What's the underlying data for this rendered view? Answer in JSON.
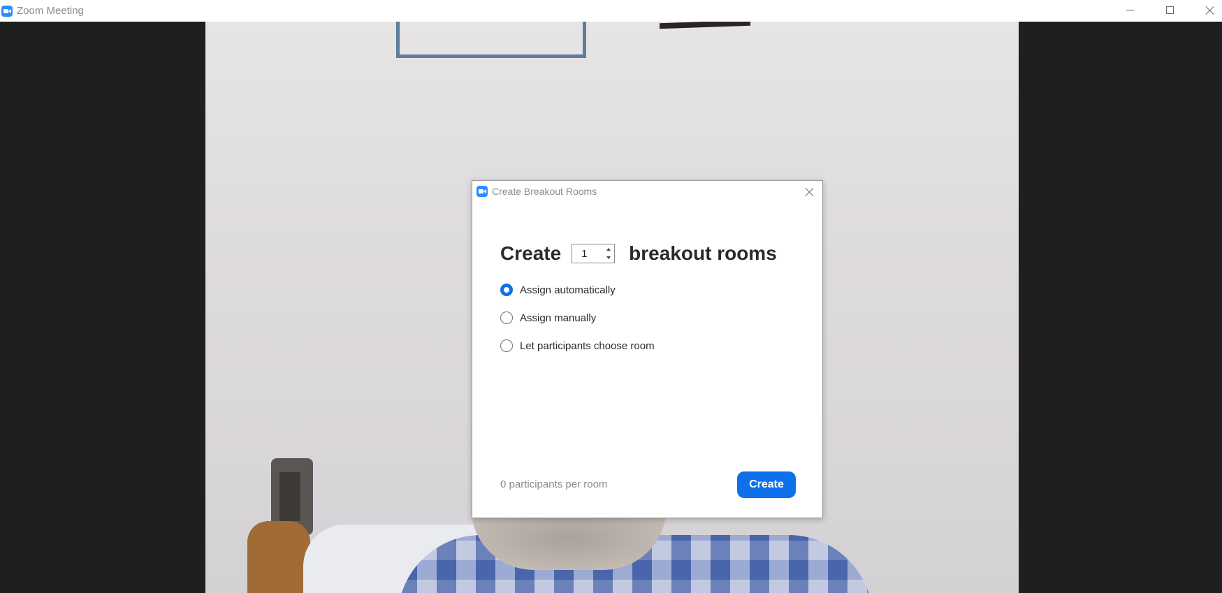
{
  "window": {
    "title": "Zoom Meeting",
    "controls": [
      "minimize",
      "maximize",
      "close"
    ]
  },
  "dialog": {
    "title": "Create Breakout Rooms",
    "create_prefix": "Create",
    "room_count": "1",
    "create_suffix": "breakout rooms",
    "options": [
      {
        "label": "Assign automatically",
        "selected": true
      },
      {
        "label": "Assign manually",
        "selected": false
      },
      {
        "label": "Let participants choose room",
        "selected": false
      }
    ],
    "participants_per_room": "0 participants per room",
    "create_button": "Create"
  },
  "colors": {
    "accent": "#0e71eb",
    "zoom_icon": "#2d8cff"
  }
}
